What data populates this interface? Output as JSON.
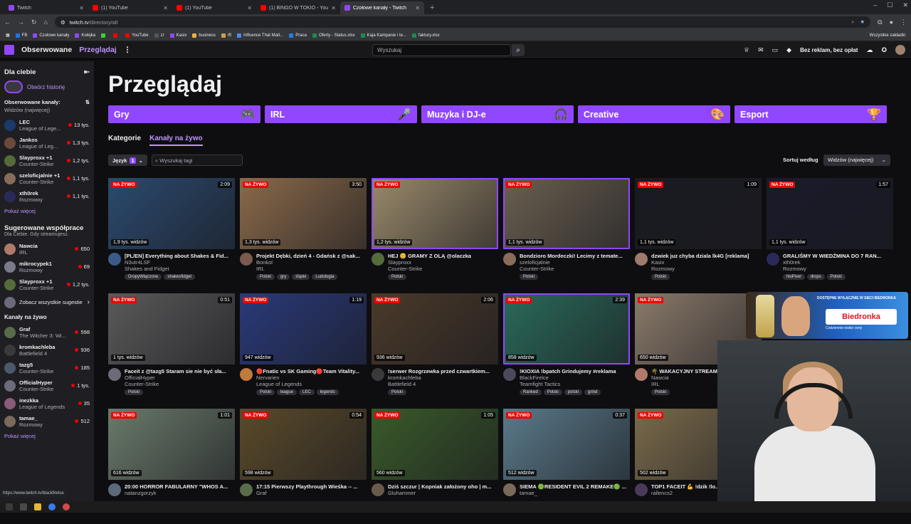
{
  "browser": {
    "tabs": [
      {
        "title": "Twitch",
        "color": "#9147ff",
        "active": false
      },
      {
        "title": "(1) YouTube",
        "color": "#ff0000",
        "active": false
      },
      {
        "title": "(1) YouTube",
        "color": "#ff0000",
        "active": false
      },
      {
        "title": "(1) BINGO W TOKIO - YouTube",
        "color": "#ff0000",
        "active": false
      },
      {
        "title": "Czołowe kanały - Twitch",
        "color": "#9147ff",
        "active": true
      }
    ],
    "url_host": "twitch.tv",
    "url_path": "/directory/all",
    "bookmarks": [
      "FB",
      "Czołowe kanały",
      "Kolejka",
      "",
      "",
      "YouTube",
      "zr",
      "Kasix",
      "business",
      "tft",
      "Influence That Matt...",
      "Praca",
      "Oferty - Status.xlsx",
      "Kaja Kampanie i te...",
      "faktury.xlsx"
    ],
    "bookmarks_all": "Wszystkie zakładki",
    "status_url": "https://www.twitch.tv/blackfirelce"
  },
  "nav": {
    "following": "Obserwowane",
    "browse": "Przeglądaj",
    "search_placeholder": "Wyszukaj",
    "adfree": "Bez reklam, bez opłat"
  },
  "sidebar": {
    "for_you": "Dla ciebie",
    "history": "Otwórz historię",
    "followed_title": "Obserwowane kanały:",
    "followed_sort": "Widzów (najwięcej)",
    "followed": [
      {
        "name": "LEC",
        "game": "League of Lege...",
        "viewers": "13 tys.",
        "color": "#1a3a6b"
      },
      {
        "name": "Jankos",
        "game": "League of Leg...",
        "viewers": "1,3 tys.",
        "color": "#6b4a3a"
      },
      {
        "name": "Slayproxx +1",
        "game": "Counter-Strike",
        "viewers": "1,2 tys.",
        "color": "#556b3a"
      },
      {
        "name": "szeloficjalnie +1",
        "game": "Counter-Strike",
        "viewers": "1,1 tys.",
        "color": "#8a6b5a"
      },
      {
        "name": "xth0rek",
        "game": "Rozmowy",
        "viewers": "1,1 tys.",
        "color": "#2a2a5a"
      }
    ],
    "show_more": "Pokaż więcej",
    "collab_title": "Sugerowane współprace",
    "collab_sub": "Dla Ciebie. Gdy streamujesz.",
    "collabs": [
      {
        "name": "Nawcia",
        "game": "IRL",
        "viewers": "650",
        "color": "#b07a6a"
      },
      {
        "name": "mikrocypek1",
        "game": "Rozmowy",
        "viewers": "69",
        "color": "#7a7a8a"
      },
      {
        "name": "Slayproxx +1",
        "game": "Counter-Strike",
        "viewers": "1,2 tys.",
        "color": "#556b3a"
      }
    ],
    "see_all": "Zobacz wszystkie sugestie",
    "live_title": "Kanały na żywo",
    "live": [
      {
        "name": "Graf",
        "game": "The Witcher 3: Wi...",
        "viewers": "598",
        "color": "#5a6b4a"
      },
      {
        "name": "kromkachleba",
        "game": "Battlefield 4",
        "viewers": "936",
        "color": "#3a3a3a"
      },
      {
        "name": "tazg5",
        "game": "Counter-Strike",
        "viewers": "185",
        "color": "#4a5a6b"
      },
      {
        "name": "OfficialHyper",
        "game": "Counter-Strike",
        "viewers": "1 tys.",
        "color": "#6b6b7a"
      },
      {
        "name": "inezkka",
        "game": "League of Legends",
        "viewers": "35",
        "color": "#8a5a7a"
      },
      {
        "name": "tamae_",
        "game": "Rozmowy",
        "viewers": "512",
        "color": "#7a6a5a"
      }
    ],
    "show_more2": "Pokaż więcej"
  },
  "main": {
    "title": "Przeglądaj",
    "categories": [
      "Gry",
      "IRL",
      "Muzyka i DJ-e",
      "Creative",
      "Esport"
    ],
    "category_icons": [
      "gamepad-icon",
      "microphone-icon",
      "headphones-icon",
      "palette-icon",
      "trophy-icon"
    ],
    "tabs": [
      "Kategorie",
      "Kanały na żywo"
    ],
    "lang_label": "Język",
    "lang_count": "1",
    "tag_placeholder": "Wyszukaj tagi",
    "sort_label": "Sortuj według",
    "sort_value": "Widzów (najwięcej)",
    "live_badge": "NA ŻYWO"
  },
  "streams": [
    {
      "dur": "2:09",
      "viewers": "1,9 tys. widzów",
      "title": "[PL/EN] Everything about Shakes & Fid...",
      "channel": "N3utr4LSF",
      "game": "Shakes and Fidget",
      "tags": [
        "DropyWłączone",
        "shakesfidget"
      ],
      "bg": "#2b4a6e",
      "av": "#3a5a8a"
    },
    {
      "dur": "3:50",
      "viewers": "1,3 tys. widzów",
      "title": "Projekt Dębki, dzień 4 - Gdańsk z @sak...",
      "channel": "Bonkol",
      "game": "IRL",
      "tags": [
        "Polski",
        "gry",
        "śląski",
        "Ludologia"
      ],
      "bg": "#8a6a4a",
      "av": "#7a5a4a"
    },
    {
      "dur": "",
      "viewers": "1,2 tys. widzów",
      "title": "HEJ 😊 GRAMY Z OLĄ @olaczka",
      "channel": "Slayproxx",
      "game": "Counter-Strike",
      "tags": [
        "Polski"
      ],
      "bg": "#9a8a6a",
      "av": "#556b3a",
      "sel": true
    },
    {
      "dur": "",
      "viewers": "1,1 tys. widzów",
      "title": "Bondzioro Mordeczki! Lecimy z temate...",
      "channel": "szeloficjalnie",
      "game": "Counter-Strike",
      "tags": [
        "Polski"
      ],
      "bg": "#6a6050",
      "av": "#8a6b5a",
      "sel": true
    },
    {
      "dur": "1:09",
      "viewers": "1,1 tys. widzów",
      "title": "dzwiek juz chyba dziala lk4G [reklama]",
      "channel": "Kasix",
      "game": "Rozmowy",
      "tags": [
        "Polski"
      ],
      "bg": "#1a1a22",
      "av": "#a07a6a"
    },
    {
      "dur": "1:57",
      "viewers": "1,1 tys. widzów",
      "title": "GRALIŚMY W WIEDŹMINA DO 7 RAN...",
      "channel": "xth0rek",
      "game": "Rozmowy",
      "tags": [
        "NoPixel",
        "drops",
        "Polski"
      ],
      "bg": "#1a1a2a",
      "av": "#2a2a5a"
    },
    {
      "dur": "0:51",
      "viewers": "1 tys. widzów",
      "title": "Faceit z @tazg5 Staram sie nie być sła...",
      "channel": "OfficialHyper",
      "game": "Counter-Strike",
      "tags": [
        "Polski"
      ],
      "bg": "#5a5a5a",
      "av": "#6b6b7a"
    },
    {
      "dur": "1:19",
      "viewers": "947 widzów",
      "title": "🔴Fnatic vs SK Gaming🔴Team Vitality...",
      "channel": "Nervarien",
      "game": "League of Legends",
      "tags": [
        "Polski",
        "league",
        "LEC",
        "legends"
      ],
      "bg": "#2a3a7a",
      "av": "#c07a3a"
    },
    {
      "dur": "2:06",
      "viewers": "936 widzów",
      "title": "!serwer Rozgrzewka przed czwartkiem...",
      "channel": "kromkachleba",
      "game": "Battlefield 4",
      "tags": [
        "Polski"
      ],
      "bg": "#4a3a2a",
      "av": "#3a3a3a"
    },
    {
      "dur": "2:39",
      "viewers": "858 widzów",
      "title": "!KIOXIA !bpatch Grindujemy #reklama",
      "channel": "BlackFirelce",
      "game": "Teamfight Tactics",
      "tags": [
        "Ranked",
        "Polski",
        "polski",
        "grind"
      ],
      "bg": "#2a6a5a",
      "av": "#4a4a5a",
      "sel": true
    },
    {
      "dur": "3:3",
      "viewers": "650 widzów",
      "title": "🌴 WAKACYJNY STREAM",
      "channel": "Nawcia",
      "game": "IRL",
      "tags": [
        "Polski"
      ],
      "bg": "#8a7a6a",
      "av": "#b07a6a"
    },
    {
      "dur": "",
      "viewers": "",
      "title": "",
      "channel": "",
      "game": "",
      "tags": [],
      "bg": "#0e0e10",
      "av": "#0e0e10",
      "hidden": true
    },
    {
      "dur": "1:01",
      "viewers": "616 widzów",
      "title": "20:00 HORROR FABULARNY \"WHOS A...",
      "channel": "natanzgorzyk",
      "game": "",
      "tags": [],
      "bg": "#6a7a6a",
      "av": "#5a6a7a"
    },
    {
      "dur": "0:54",
      "viewers": "598 widzów",
      "title": "17:15 Pierwszy Playthrough Wieśka -- ...",
      "channel": "Graf",
      "game": "",
      "tags": [],
      "bg": "#5a4a2a",
      "av": "#5a6b4a"
    },
    {
      "dur": "1:05",
      "viewers": "560 widzów",
      "title": "Dziś szczur | Kopniak założony oho | m...",
      "channel": "Gluhammer",
      "game": "",
      "tags": [],
      "bg": "#3a5a2a",
      "av": "#6a5a4a"
    },
    {
      "dur": "0:37",
      "viewers": "512 widzów",
      "title": "SIEMA 🟢RESIDENT EVIL 2 REMAKE🟢 ...",
      "channel": "tamae_",
      "game": "",
      "tags": [],
      "bg": "#5a7a8a",
      "av": "#7a6a5a"
    },
    {
      "dur": "",
      "viewers": "502 widzów",
      "title": "TOP1 FACEIT 💪 !dzik !lo...",
      "channel": "rallencs2",
      "game": "",
      "tags": [],
      "bg": "#7a6a4a",
      "av": "#4a3a5a"
    }
  ],
  "overlay": {
    "ad_top": "DOSTĘPNE WYŁĄCZNIE W SIECI BIEDRONKA",
    "ad_brand": "Biedronka",
    "ad_sub": "Codziennie niskie ceny"
  },
  "colors": {
    "accent": "#9147ff",
    "live": "#eb0400",
    "bg": "#0e0e10"
  }
}
